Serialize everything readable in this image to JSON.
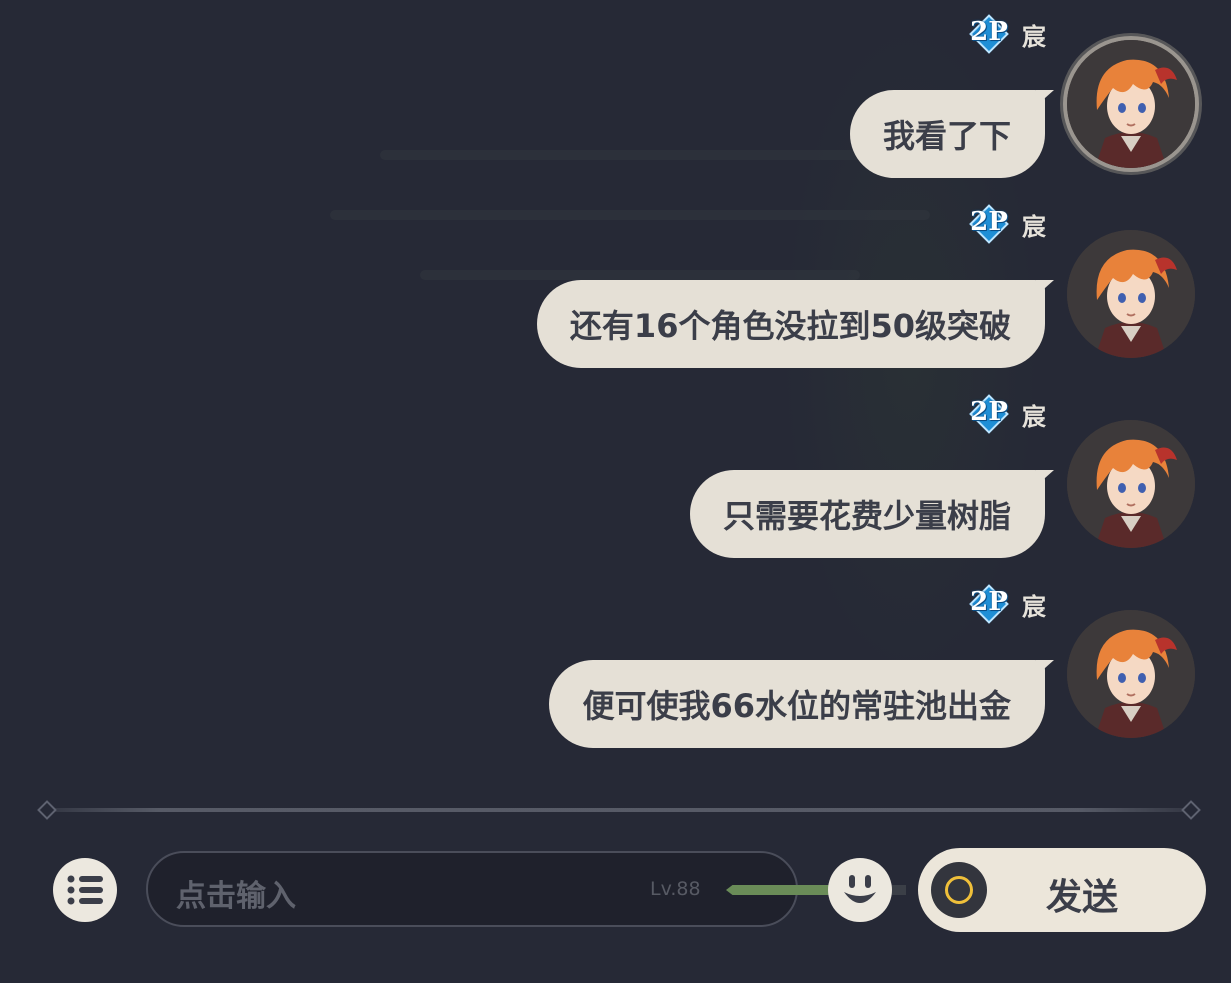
{
  "messages": [
    {
      "badge": "2P",
      "sender": "宸",
      "text": "我看了下",
      "active": true
    },
    {
      "badge": "2P",
      "sender": "宸",
      "text": "还有16个角色没拉到50级突破",
      "active": false
    },
    {
      "badge": "2P",
      "sender": "宸",
      "text": "只需要花费少量树脂",
      "active": false
    },
    {
      "badge": "2P",
      "sender": "宸",
      "text": "便可使我66水位的常驻池出金",
      "active": false
    }
  ],
  "input": {
    "placeholder": "点击输入"
  },
  "level": {
    "label": "Lv.88",
    "progress_fraction": 0.6
  },
  "send": {
    "label": "发送"
  },
  "icons": {
    "menu": "list-icon",
    "emoji": "smiley-icon",
    "send_ring": "ring-icon",
    "badge": "2p-badge-icon"
  },
  "colors": {
    "background": "#262936",
    "bubble": "#e5e0d6",
    "bubble_text": "#3b3e49",
    "badge": "#1f8fd6",
    "accent_gold": "#f0c03a"
  }
}
